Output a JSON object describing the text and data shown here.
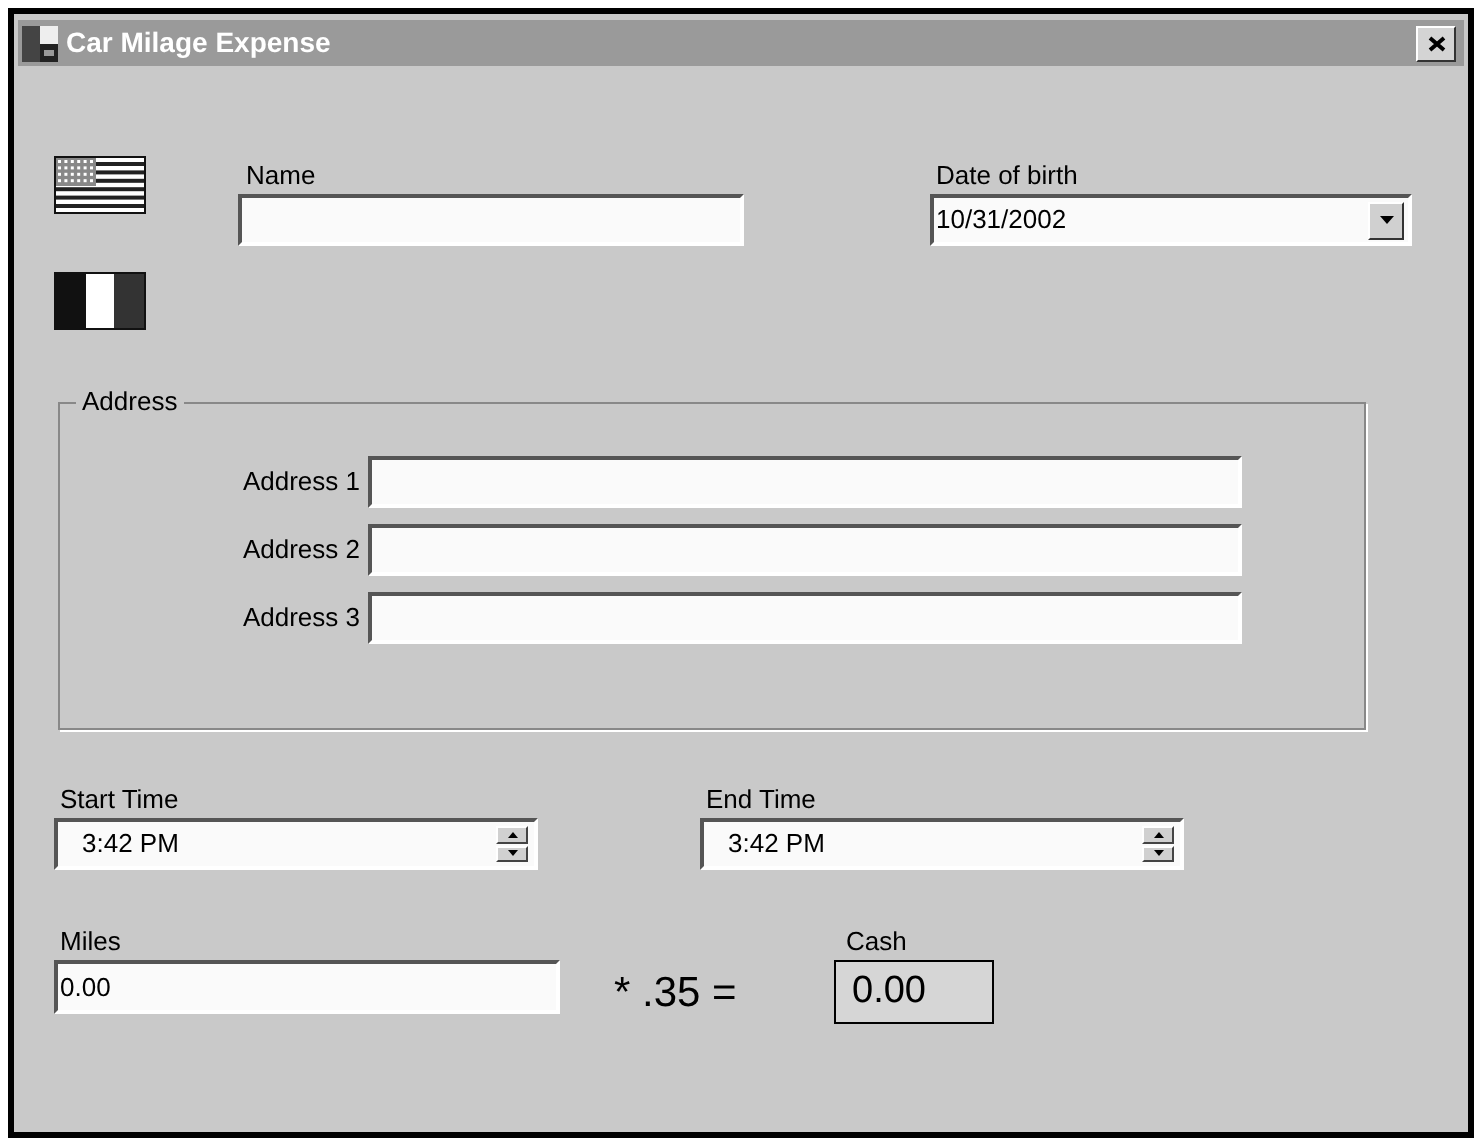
{
  "window": {
    "title": "Car Milage Expense"
  },
  "name": {
    "label": "Name"
  },
  "date_of_birth": {
    "label": "Date of birth",
    "value": "10/31/2002"
  },
  "address": {
    "title": "Address",
    "fields": [
      {
        "label": "Address 1"
      },
      {
        "label": "Address 2"
      },
      {
        "label": "Address 3"
      }
    ]
  },
  "start_time": {
    "label": "Start Time",
    "value": "3:42 PM"
  },
  "end_time": {
    "label": "End Time",
    "value": "3:42 PM"
  },
  "miles": {
    "label": "Miles",
    "value": "0.00"
  },
  "formula": "* .35 =",
  "cash": {
    "label": "Cash",
    "value": "0.00"
  }
}
